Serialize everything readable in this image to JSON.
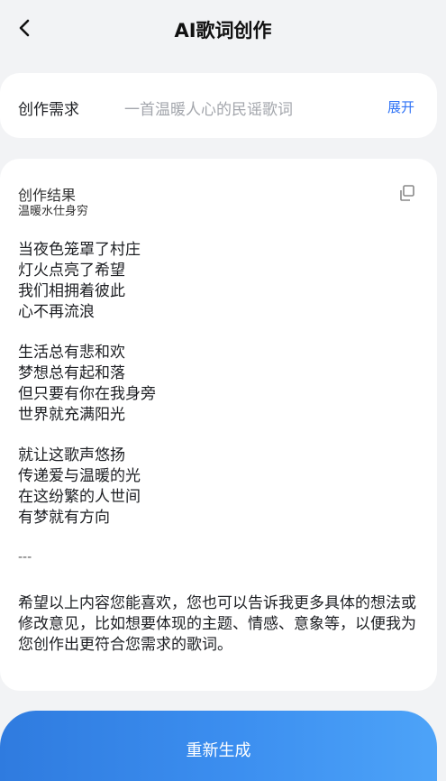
{
  "header": {
    "title": "AI歌词创作",
    "back_icon": "chevron-left-icon"
  },
  "request": {
    "label": "创作需求",
    "value": "一首温暖人心的民谣歌词",
    "expand_label": "展开"
  },
  "result": {
    "title": "创作结果",
    "subtitle": "温暖水仕身穷",
    "copy_icon": "copy-icon",
    "stanzas": [
      [
        "当夜色笼罩了村庄",
        "灯火点亮了希望",
        "我们相拥着彼此",
        "心不再流浪"
      ],
      [
        "生活总有悲和欢",
        "梦想总有起和落",
        "但只要有你在我身旁",
        "世界就充满阳光"
      ],
      [
        "就让这歌声悠扬",
        "传递爱与温暖的光",
        "在这纷繁的人世间",
        "有梦就有方向"
      ]
    ],
    "separator": "---",
    "closing": "希望以上内容您能喜欢，您也可以告诉我更多具体的想法或修改意见，比如想要体现的主题、情感、意象等，以便我为您创作出更符合您需求的歌词。"
  },
  "footer": {
    "regenerate_label": "重新生成"
  },
  "colors": {
    "accent": "#2f73f6",
    "button_start": "#2f7bdf",
    "button_end": "#4da3f8",
    "background": "#f2f3f5"
  }
}
